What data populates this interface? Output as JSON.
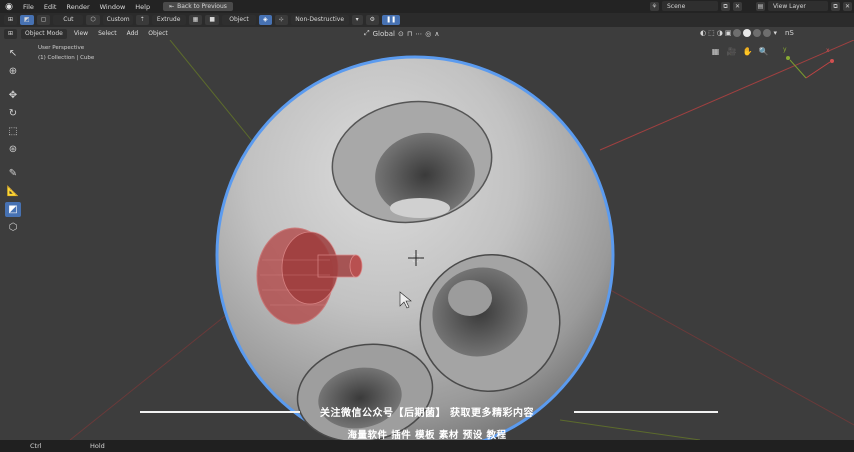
{
  "menubar": {
    "items": [
      "File",
      "Edit",
      "Render",
      "Window",
      "Help"
    ],
    "back_button": "Back to Previous",
    "scene": "Scene",
    "view_layer": "View Layer"
  },
  "toolheader": {
    "cut": "Cut",
    "custom": "Custom",
    "extrude": "Extrude",
    "object": "Object",
    "mode": "Non-Destructive"
  },
  "viewport_header": {
    "mode": "Object Mode",
    "menus": [
      "View",
      "Select",
      "Add",
      "Object"
    ],
    "orientation": "Global",
    "nS": "nS"
  },
  "viewport": {
    "perspective": "User Perspective",
    "collection": "(1) Collection | Cube"
  },
  "subtitle": {
    "line1": "关注微信公众号【后期菌】 获取更多精彩内容",
    "line2": "海量软件 插件 模板 素材 预设 教程"
  },
  "statusbar": {
    "key": "Ctrl",
    "action": "Hold"
  },
  "colors": {
    "accent": "#4772b3",
    "sphere_outline": "#5b9bef",
    "cutter": "#b34a4a",
    "x_axis": "#b84646",
    "y_axis": "#7a9a2e"
  },
  "icons": {
    "tools": [
      "cursor-select-icon",
      "cursor-icon",
      "move-icon",
      "rotate-icon",
      "scale-icon",
      "transform-icon",
      "annotate-icon",
      "measure-icon",
      "boxcutter-icon",
      "add-cube-icon"
    ]
  }
}
